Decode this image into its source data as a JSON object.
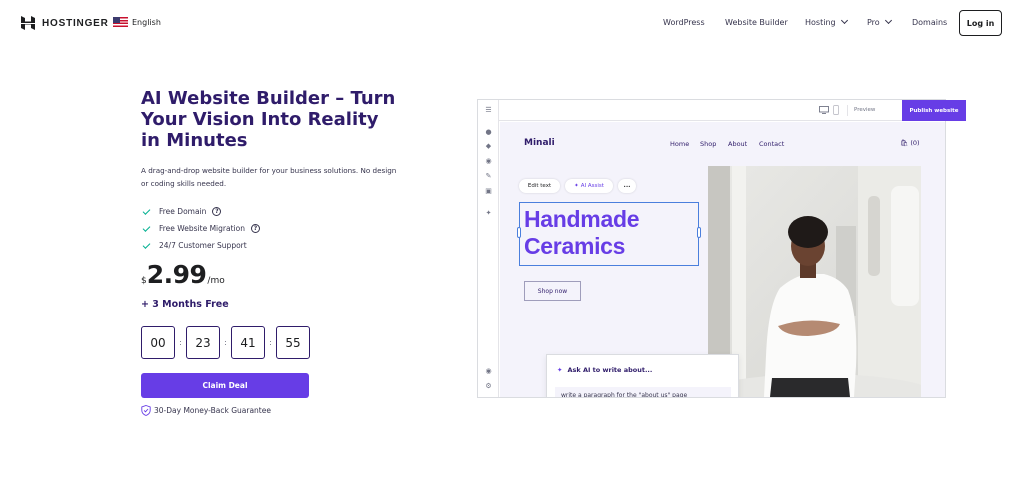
{
  "nav": {
    "brand": "HOSTINGER",
    "language": "English",
    "links": [
      {
        "label": "WordPress",
        "dropdown": false
      },
      {
        "label": "Website Builder",
        "dropdown": false
      },
      {
        "label": "Hosting",
        "dropdown": true
      },
      {
        "label": "Pro",
        "dropdown": true
      },
      {
        "label": "Domains",
        "dropdown": false
      }
    ],
    "login": "Log in"
  },
  "hero": {
    "title": "AI Website Builder – Turn Your Vision Into Reality in Minutes",
    "description": "A drag-and-drop website builder for your business solutions. No design or coding skills needed.",
    "features": [
      "Free Domain",
      "Free Website Migration",
      "24/7 Customer Support"
    ],
    "price_currency": "$",
    "price_value": "2.99",
    "price_period": "/mo",
    "bonus": "+ 3 Months Free",
    "timer": [
      "00",
      "23",
      "41",
      "55"
    ],
    "cta": "Claim Deal",
    "guarantee": "30-Day Money-Back Guarantee"
  },
  "builder": {
    "preview": "Preview",
    "publish": "Publish website",
    "site_name": "Minali",
    "site_nav": [
      "Home",
      "Shop",
      "About",
      "Contact"
    ],
    "cart": "(0)",
    "toolbar": {
      "edit_text": "Edit text",
      "ai_assist": "AI Assist",
      "more": "•••"
    },
    "headline_line1": "Handmade",
    "headline_line2": "Ceramics",
    "shop_now": "Shop now",
    "ai_prompt_title": "Ask AI to write about...",
    "ai_prompt_text": "write a paragraph for the \"about us\" page"
  },
  "colors": {
    "brand_purple": "#673de6",
    "heading_navy": "#2f1c6a",
    "check_green": "#00b090"
  }
}
